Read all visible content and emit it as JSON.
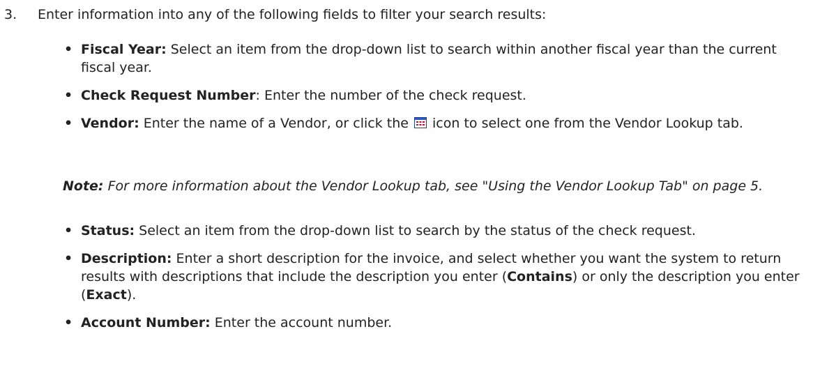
{
  "step": {
    "number": "3.",
    "text": "Enter information into any of the following fields to filter your search results:"
  },
  "fields_top": [
    {
      "label": "Fiscal Year:",
      "text": " Select an item from the drop-down list to search within another fiscal year than the current fiscal year."
    },
    {
      "label": "Check Request Number",
      "text": ": Enter the number of the check request."
    },
    {
      "label": "Vendor:",
      "text_before_icon": " Enter the name of a Vendor, or click the ",
      "text_after_icon": " icon to select one from the Vendor Lookup tab."
    }
  ],
  "note": {
    "label": "Note:",
    "text": " For more information about the Vendor Lookup tab, see \"Using the Vendor Lookup Tab\" on page 5."
  },
  "fields_bottom": {
    "status": {
      "label": "Status:",
      "text": " Select an item from the drop-down list to search by the status of the check request."
    },
    "description": {
      "label": "Description:",
      "text_1": " Enter a short description for the invoice, and select whether you want the system to return results with descriptions that include the description you enter (",
      "contains": "Contains",
      "text_2": ") or only the description you enter (",
      "exact": "Exact",
      "text_3": ")."
    },
    "account": {
      "label": "Account Number:",
      "text": " Enter the account number."
    }
  },
  "icons": {
    "lookup": "lookup-grid-icon"
  },
  "colors": {
    "text": "#222222",
    "icon_red": "#c8102e"
  }
}
